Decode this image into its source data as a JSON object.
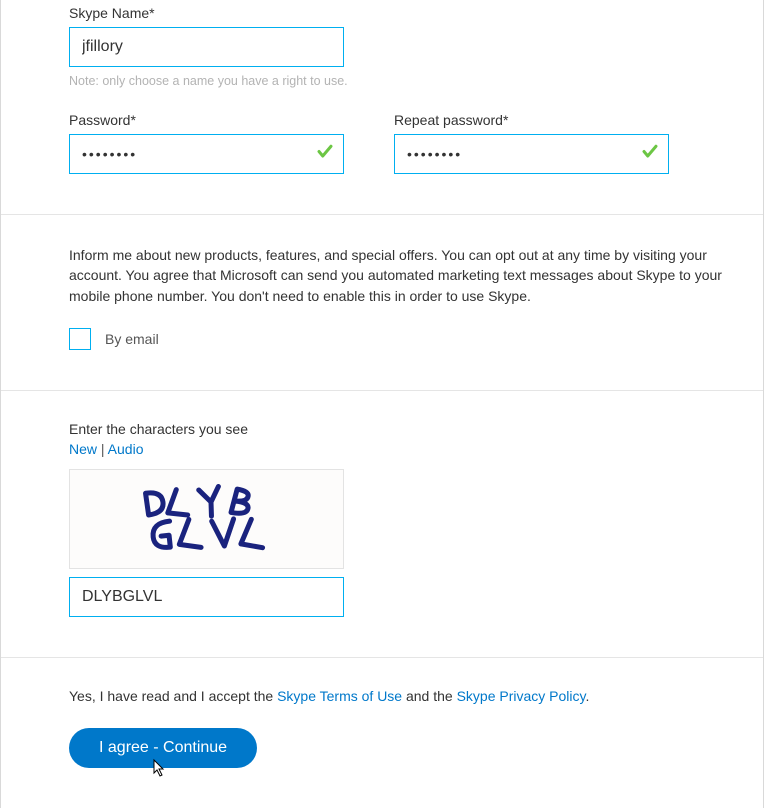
{
  "skype_name": {
    "label": "Skype Name*",
    "value": "jfillory",
    "hint": "Note: only choose a name you have a right to use."
  },
  "password": {
    "label": "Password*",
    "value": "••••••••",
    "valid": "✓"
  },
  "repeat_password": {
    "label": "Repeat password*",
    "value": "••••••••",
    "valid": "✓"
  },
  "marketing": {
    "text": "Inform me about new products, features, and special offers. You can opt out at any time by visiting your account. You agree that Microsoft can send you automated marketing text messages about Skype to your mobile phone number. You don't need to enable this in order to use Skype.",
    "email_label": "By email"
  },
  "captcha": {
    "prompt": "Enter the characters you see",
    "new_label": "New",
    "audio_label": "Audio",
    "input_value": "DLYBGLVL"
  },
  "terms": {
    "prefix": "Yes, I have read and I accept the ",
    "tos": "Skype Terms of Use",
    "mid": " and the ",
    "privacy": "Skype Privacy Policy",
    "suffix": "."
  },
  "submit": {
    "label": "I agree - Continue"
  }
}
